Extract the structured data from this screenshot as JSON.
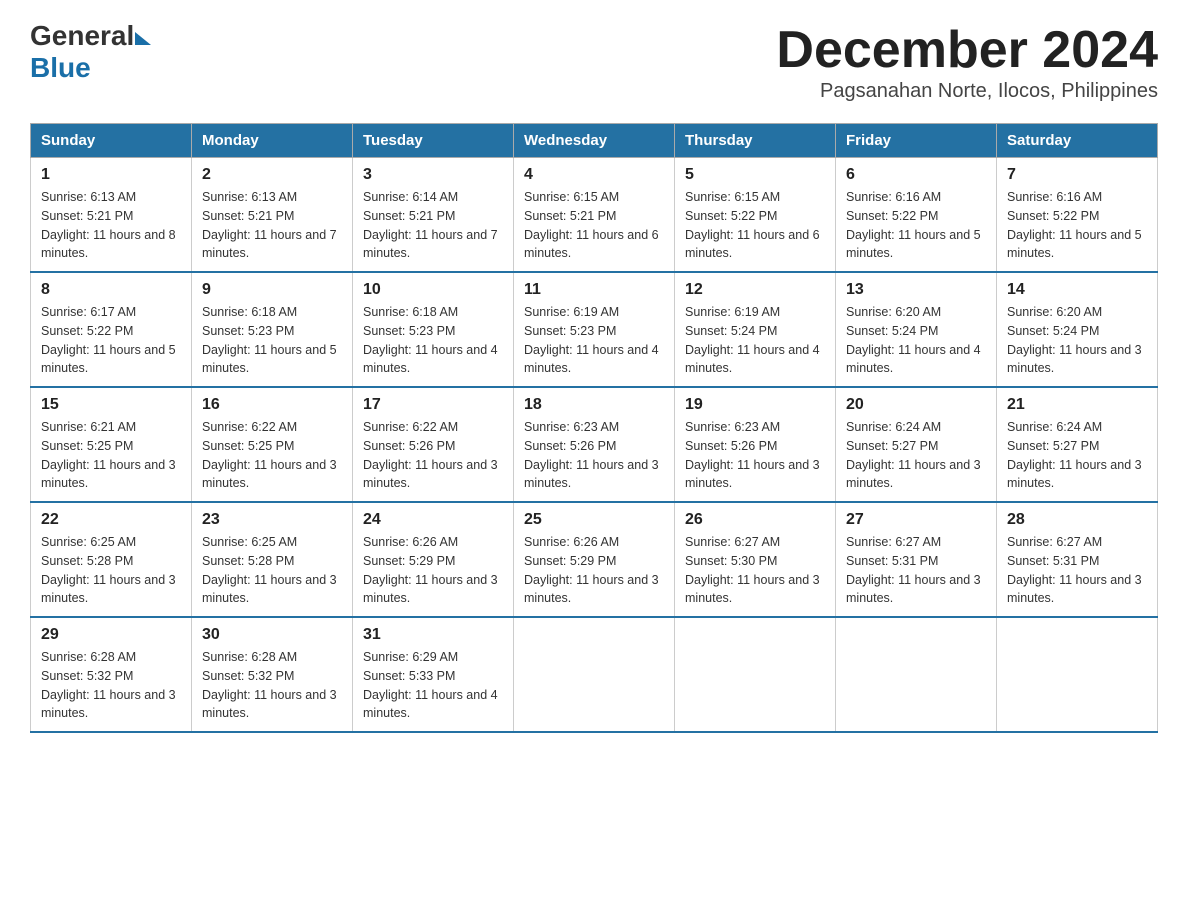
{
  "logo": {
    "general": "General",
    "blue": "Blue"
  },
  "header": {
    "month_year": "December 2024",
    "location": "Pagsanahan Norte, Ilocos, Philippines"
  },
  "columns": [
    "Sunday",
    "Monday",
    "Tuesday",
    "Wednesday",
    "Thursday",
    "Friday",
    "Saturday"
  ],
  "weeks": [
    [
      {
        "day": "1",
        "sunrise": "Sunrise: 6:13 AM",
        "sunset": "Sunset: 5:21 PM",
        "daylight": "Daylight: 11 hours and 8 minutes."
      },
      {
        "day": "2",
        "sunrise": "Sunrise: 6:13 AM",
        "sunset": "Sunset: 5:21 PM",
        "daylight": "Daylight: 11 hours and 7 minutes."
      },
      {
        "day": "3",
        "sunrise": "Sunrise: 6:14 AM",
        "sunset": "Sunset: 5:21 PM",
        "daylight": "Daylight: 11 hours and 7 minutes."
      },
      {
        "day": "4",
        "sunrise": "Sunrise: 6:15 AM",
        "sunset": "Sunset: 5:21 PM",
        "daylight": "Daylight: 11 hours and 6 minutes."
      },
      {
        "day": "5",
        "sunrise": "Sunrise: 6:15 AM",
        "sunset": "Sunset: 5:22 PM",
        "daylight": "Daylight: 11 hours and 6 minutes."
      },
      {
        "day": "6",
        "sunrise": "Sunrise: 6:16 AM",
        "sunset": "Sunset: 5:22 PM",
        "daylight": "Daylight: 11 hours and 5 minutes."
      },
      {
        "day": "7",
        "sunrise": "Sunrise: 6:16 AM",
        "sunset": "Sunset: 5:22 PM",
        "daylight": "Daylight: 11 hours and 5 minutes."
      }
    ],
    [
      {
        "day": "8",
        "sunrise": "Sunrise: 6:17 AM",
        "sunset": "Sunset: 5:22 PM",
        "daylight": "Daylight: 11 hours and 5 minutes."
      },
      {
        "day": "9",
        "sunrise": "Sunrise: 6:18 AM",
        "sunset": "Sunset: 5:23 PM",
        "daylight": "Daylight: 11 hours and 5 minutes."
      },
      {
        "day": "10",
        "sunrise": "Sunrise: 6:18 AM",
        "sunset": "Sunset: 5:23 PM",
        "daylight": "Daylight: 11 hours and 4 minutes."
      },
      {
        "day": "11",
        "sunrise": "Sunrise: 6:19 AM",
        "sunset": "Sunset: 5:23 PM",
        "daylight": "Daylight: 11 hours and 4 minutes."
      },
      {
        "day": "12",
        "sunrise": "Sunrise: 6:19 AM",
        "sunset": "Sunset: 5:24 PM",
        "daylight": "Daylight: 11 hours and 4 minutes."
      },
      {
        "day": "13",
        "sunrise": "Sunrise: 6:20 AM",
        "sunset": "Sunset: 5:24 PM",
        "daylight": "Daylight: 11 hours and 4 minutes."
      },
      {
        "day": "14",
        "sunrise": "Sunrise: 6:20 AM",
        "sunset": "Sunset: 5:24 PM",
        "daylight": "Daylight: 11 hours and 3 minutes."
      }
    ],
    [
      {
        "day": "15",
        "sunrise": "Sunrise: 6:21 AM",
        "sunset": "Sunset: 5:25 PM",
        "daylight": "Daylight: 11 hours and 3 minutes."
      },
      {
        "day": "16",
        "sunrise": "Sunrise: 6:22 AM",
        "sunset": "Sunset: 5:25 PM",
        "daylight": "Daylight: 11 hours and 3 minutes."
      },
      {
        "day": "17",
        "sunrise": "Sunrise: 6:22 AM",
        "sunset": "Sunset: 5:26 PM",
        "daylight": "Daylight: 11 hours and 3 minutes."
      },
      {
        "day": "18",
        "sunrise": "Sunrise: 6:23 AM",
        "sunset": "Sunset: 5:26 PM",
        "daylight": "Daylight: 11 hours and 3 minutes."
      },
      {
        "day": "19",
        "sunrise": "Sunrise: 6:23 AM",
        "sunset": "Sunset: 5:26 PM",
        "daylight": "Daylight: 11 hours and 3 minutes."
      },
      {
        "day": "20",
        "sunrise": "Sunrise: 6:24 AM",
        "sunset": "Sunset: 5:27 PM",
        "daylight": "Daylight: 11 hours and 3 minutes."
      },
      {
        "day": "21",
        "sunrise": "Sunrise: 6:24 AM",
        "sunset": "Sunset: 5:27 PM",
        "daylight": "Daylight: 11 hours and 3 minutes."
      }
    ],
    [
      {
        "day": "22",
        "sunrise": "Sunrise: 6:25 AM",
        "sunset": "Sunset: 5:28 PM",
        "daylight": "Daylight: 11 hours and 3 minutes."
      },
      {
        "day": "23",
        "sunrise": "Sunrise: 6:25 AM",
        "sunset": "Sunset: 5:28 PM",
        "daylight": "Daylight: 11 hours and 3 minutes."
      },
      {
        "day": "24",
        "sunrise": "Sunrise: 6:26 AM",
        "sunset": "Sunset: 5:29 PM",
        "daylight": "Daylight: 11 hours and 3 minutes."
      },
      {
        "day": "25",
        "sunrise": "Sunrise: 6:26 AM",
        "sunset": "Sunset: 5:29 PM",
        "daylight": "Daylight: 11 hours and 3 minutes."
      },
      {
        "day": "26",
        "sunrise": "Sunrise: 6:27 AM",
        "sunset": "Sunset: 5:30 PM",
        "daylight": "Daylight: 11 hours and 3 minutes."
      },
      {
        "day": "27",
        "sunrise": "Sunrise: 6:27 AM",
        "sunset": "Sunset: 5:31 PM",
        "daylight": "Daylight: 11 hours and 3 minutes."
      },
      {
        "day": "28",
        "sunrise": "Sunrise: 6:27 AM",
        "sunset": "Sunset: 5:31 PM",
        "daylight": "Daylight: 11 hours and 3 minutes."
      }
    ],
    [
      {
        "day": "29",
        "sunrise": "Sunrise: 6:28 AM",
        "sunset": "Sunset: 5:32 PM",
        "daylight": "Daylight: 11 hours and 3 minutes."
      },
      {
        "day": "30",
        "sunrise": "Sunrise: 6:28 AM",
        "sunset": "Sunset: 5:32 PM",
        "daylight": "Daylight: 11 hours and 3 minutes."
      },
      {
        "day": "31",
        "sunrise": "Sunrise: 6:29 AM",
        "sunset": "Sunset: 5:33 PM",
        "daylight": "Daylight: 11 hours and 4 minutes."
      },
      null,
      null,
      null,
      null
    ]
  ]
}
